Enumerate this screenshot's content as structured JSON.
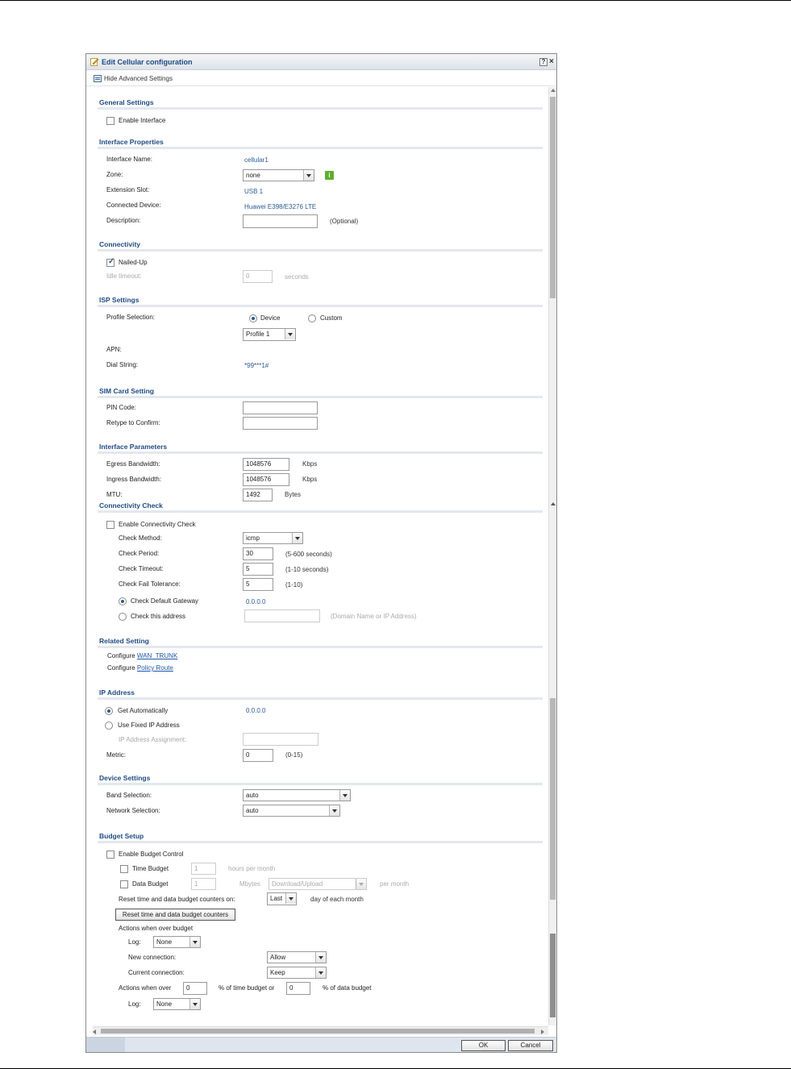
{
  "dialog": {
    "title": "Edit Cellular configuration",
    "help": "?",
    "close": "×",
    "advanced_toggle": "Hide Advanced Settings",
    "ok": "OK",
    "cancel": "Cancel"
  },
  "general": {
    "header": "General Settings",
    "enable_interface": "Enable Interface",
    "enable_interface_checked": false
  },
  "interface_props": {
    "header": "Interface Properties",
    "name_label": "Interface Name:",
    "name_value": "cellular1",
    "zone_label": "Zone:",
    "zone_value": "none",
    "slot_label": "Extension Slot:",
    "slot_value": "USB 1",
    "device_label": "Connected Device:",
    "device_value": "Huawei E398/E3276 LTE",
    "desc_label": "Description:",
    "desc_value": "",
    "desc_hint": "(Optional)"
  },
  "connectivity": {
    "header": "Connectivity",
    "nailed_up": "Nailed-Up",
    "nailed_up_checked": true,
    "idle_label": "Idle timeout:",
    "idle_value": "0",
    "idle_unit": "seconds"
  },
  "isp": {
    "header": "ISP Settings",
    "profile_label": "Profile Selection:",
    "device_option": "Device",
    "custom_option": "Custom",
    "profile_value": "Profile 1",
    "apn_label": "APN:",
    "apn_value": "",
    "dial_label": "Dial String:",
    "dial_value": "*99***1#"
  },
  "sim": {
    "header": "SIM Card Setting",
    "pin_label": "PIN Code:",
    "retype_label": "Retype to Confirm:"
  },
  "params": {
    "header": "Interface Parameters",
    "egress_label": "Egress Bandwidth:",
    "egress_value": "1048576",
    "egress_unit": "Kbps",
    "ingress_label": "Ingress Bandwidth:",
    "ingress_value": "1048576",
    "ingress_unit": "Kbps",
    "mtu_label": "MTU:",
    "mtu_value": "1492",
    "mtu_unit": "Bytes"
  },
  "check": {
    "header": "Connectivity Check",
    "enable": "Enable Connectivity Check",
    "enable_checked": false,
    "method_label": "Check Method:",
    "method_value": "icmp",
    "period_label": "Check Period:",
    "period_value": "30",
    "period_hint": "(5-600 seconds)",
    "timeout_label": "Check Timeout:",
    "timeout_value": "5",
    "timeout_hint": "(1-10 seconds)",
    "tolerance_label": "Check Fail Tolerance:",
    "tolerance_value": "5",
    "tolerance_hint": "(1-10)",
    "gateway_label": "Check Default Gateway",
    "gateway_value": "0.0.0.0",
    "address_label": "Check this address",
    "address_value": "",
    "address_hint": "(Domain Name or IP Address)"
  },
  "related": {
    "header": "Related Setting",
    "configure": "Configure",
    "wan_trunk": "WAN_TRUNK",
    "policy_route": "Policy Route"
  },
  "ip": {
    "header": "IP Address",
    "auto_label": "Get Automatically",
    "auto_value": "0.0.0.0",
    "fixed_label": "Use Fixed IP Address",
    "assign_label": "IP Address Assignment:",
    "assign_value": "",
    "metric_label": "Metric:",
    "metric_value": "0",
    "metric_hint": "(0-15)"
  },
  "device": {
    "header": "Device Settings",
    "band_label": "Band Selection:",
    "band_value": "auto",
    "network_label": "Network Selection:",
    "network_value": "auto"
  },
  "budget": {
    "header": "Budget Setup",
    "enable": "Enable Budget Control",
    "time_label": "Time Budget",
    "time_value": "1",
    "time_unit": "hours per month",
    "data_label": "Data Budget",
    "data_value": "1",
    "data_unit": "Mbytes",
    "data_mode": "Download/Upload",
    "data_suffix": "per month",
    "reset_label": "Reset time and data budget counters on:",
    "reset_value": "Last",
    "reset_suffix": "day of each month",
    "reset_button": "Reset time and data budget counters",
    "actions_over": "Actions when over budget",
    "log_label": "Log:",
    "log_value": "None",
    "new_conn_label": "New connection:",
    "new_conn_value": "Allow",
    "cur_conn_label": "Current connection:",
    "cur_conn_value": "Keep",
    "actions_over2": "Actions when over",
    "pct_time_value": "0",
    "pct_time_label": "% of time budget or",
    "pct_data_value": "0",
    "pct_data_label": "% of data budget",
    "log2_label": "Log:",
    "log2_value": "None"
  }
}
